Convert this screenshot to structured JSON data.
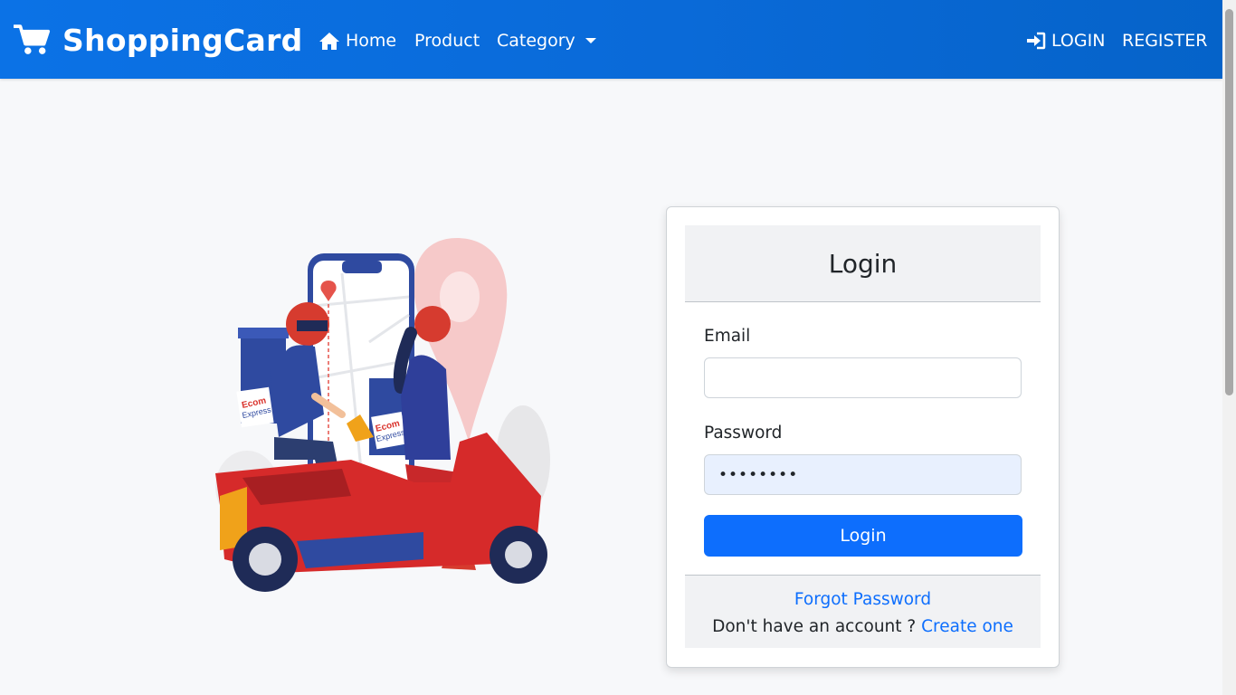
{
  "navbar": {
    "brand": "ShoppingCard",
    "links": [
      {
        "label": "Home",
        "icon": "home-icon"
      },
      {
        "label": "Product"
      },
      {
        "label": "Category",
        "icon": "caret-down-icon"
      }
    ],
    "login_label": "LOGIN",
    "register_label": "REGISTER"
  },
  "login_card": {
    "title": "Login",
    "email_label": "Email",
    "email_value": "",
    "password_label": "Password",
    "password_value": "••••••••",
    "submit_label": "Login",
    "forgot_label": "Forgot Password",
    "no_account_text": "Don't have an account ?",
    "create_label": "Create one"
  },
  "illustration": {
    "box_label_1": "Ecom",
    "box_label_2": "Express"
  },
  "colors": {
    "navbar": "#0a6ad8",
    "primary": "#0d6efd",
    "background": "#f7f8fa"
  }
}
